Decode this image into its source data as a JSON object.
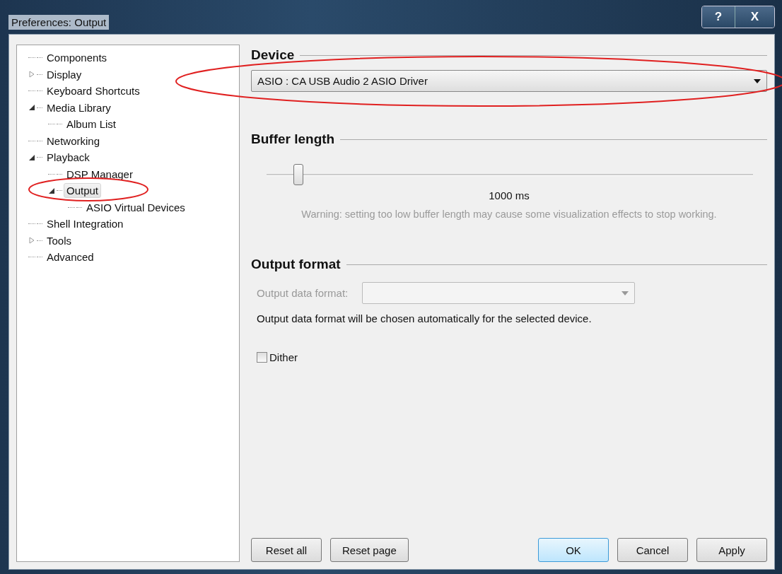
{
  "window": {
    "title": "Preferences: Output",
    "title_buttons": [
      "?",
      "X"
    ]
  },
  "tree": [
    {
      "label": "Components",
      "kind": "leaf",
      "selected": false
    },
    {
      "label": "Display",
      "kind": "collapsed",
      "selected": false
    },
    {
      "label": "Keyboard Shortcuts",
      "kind": "leaf",
      "selected": false
    },
    {
      "label": "Media Library",
      "kind": "expanded",
      "selected": false,
      "children": [
        {
          "label": "Album List",
          "kind": "leaf",
          "selected": false
        }
      ]
    },
    {
      "label": "Networking",
      "kind": "leaf",
      "selected": false
    },
    {
      "label": "Playback",
      "kind": "expanded",
      "selected": false,
      "children": [
        {
          "label": "DSP Manager",
          "kind": "leaf",
          "selected": false
        },
        {
          "label": "Output",
          "kind": "expanded",
          "selected": true,
          "children": [
            {
              "label": "ASIO Virtual Devices",
              "kind": "leaf",
              "selected": false
            }
          ]
        }
      ]
    },
    {
      "label": "Shell Integration",
      "kind": "leaf",
      "selected": false
    },
    {
      "label": "Tools",
      "kind": "collapsed",
      "selected": false
    },
    {
      "label": "Advanced",
      "kind": "leaf",
      "selected": false
    }
  ],
  "device": {
    "heading": "Device",
    "value": "ASIO : CA USB Audio 2 ASIO Driver"
  },
  "buffer": {
    "heading": "Buffer length",
    "level": 0.066,
    "reading": "1000 ms",
    "warning": "Warning: setting too low buffer length may cause some visualization effects to stop working."
  },
  "output_format": {
    "heading": "Output format",
    "label": "Output data format:",
    "disabled": true,
    "note": "Output data format will be chosen automatically for the selected device.",
    "dither": {
      "label": "Dither",
      "checked": false
    }
  },
  "buttons_left": [
    "Reset all",
    "Reset page"
  ],
  "buttons_right": [
    {
      "label": "OK",
      "default": true
    },
    {
      "label": "Cancel",
      "default": false
    },
    {
      "label": "Apply",
      "default": false
    }
  ]
}
